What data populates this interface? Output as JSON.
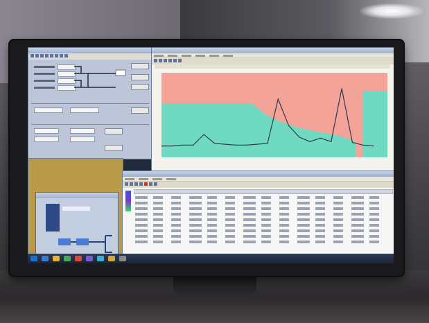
{
  "scene": {
    "description_free": true
  },
  "screen": {
    "left_panel": {
      "rows": 6
    },
    "chart": {
      "fill_colors": {
        "background": "#f4a398",
        "area": "#6fd9c2",
        "line": "#2b3b4d"
      }
    },
    "taskbar": {
      "icon_colors": [
        "#3a7bd5",
        "#e7b33a",
        "#4aa85a",
        "#d94a3a",
        "#7a5ad5",
        "#3ab0d5",
        "#d5a63a",
        "#8a8a8a"
      ]
    }
  },
  "chart_data": {
    "type": "line",
    "title": "",
    "xlabel": "",
    "ylabel": "",
    "x": [
      0,
      5,
      10,
      15,
      20,
      25,
      30,
      35,
      40,
      45,
      50,
      55,
      60,
      65,
      70,
      75,
      80,
      85,
      90,
      95,
      100
    ],
    "series": [
      {
        "values": [
          5,
          5,
          6,
          6,
          18,
          8,
          7,
          6,
          6,
          7,
          8,
          58,
          28,
          15,
          10,
          14,
          10,
          70,
          9,
          6,
          5
        ]
      }
    ]
  }
}
